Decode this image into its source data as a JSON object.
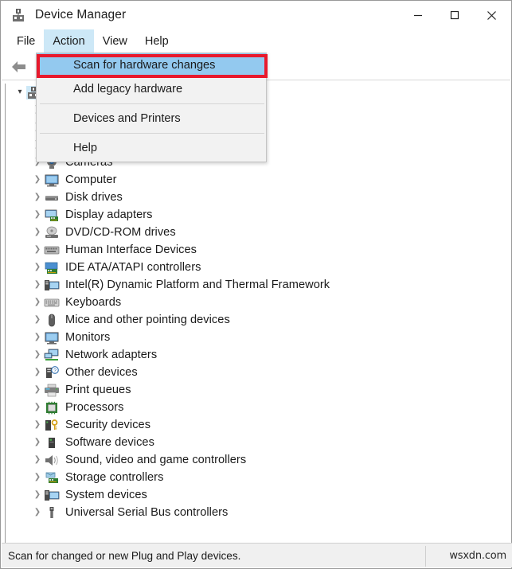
{
  "window": {
    "title": "Device Manager",
    "icon": "device-manager-icon",
    "controls": {
      "minimize": "—",
      "maximize": "□",
      "close": "✕"
    }
  },
  "menubar": {
    "items": [
      {
        "label": "File",
        "active": false
      },
      {
        "label": "Action",
        "active": true
      },
      {
        "label": "View",
        "active": false
      },
      {
        "label": "Help",
        "active": false
      }
    ]
  },
  "toolbar": {
    "buttons": [
      {
        "icon": "back-arrow-icon"
      },
      {
        "icon": "forward-arrow-icon"
      }
    ]
  },
  "dropdown": {
    "owner": "Action",
    "highlight_color": "#93c9ef",
    "annotation_color": "#e8192c",
    "items": [
      {
        "label": "Scan for hardware changes",
        "highlighted": true,
        "separator_after": false
      },
      {
        "label": "Add legacy hardware",
        "highlighted": false,
        "separator_after": true
      },
      {
        "label": "Devices and Printers",
        "highlighted": false,
        "separator_after": true
      },
      {
        "label": "Help",
        "highlighted": false,
        "separator_after": false
      }
    ]
  },
  "tree": {
    "root": {
      "label": "",
      "icon": "computer-root-icon",
      "expanded": true,
      "selected": true
    },
    "hidden_rows": 3,
    "items": [
      {
        "label": "Cameras",
        "icon": "camera-icon"
      },
      {
        "label": "Computer",
        "icon": "monitor-icon"
      },
      {
        "label": "Disk drives",
        "icon": "disk-drive-icon"
      },
      {
        "label": "Display adapters",
        "icon": "display-adapter-icon"
      },
      {
        "label": "DVD/CD-ROM drives",
        "icon": "optical-drive-icon"
      },
      {
        "label": "Human Interface Devices",
        "icon": "hid-icon"
      },
      {
        "label": "IDE ATA/ATAPI controllers",
        "icon": "ide-controller-icon"
      },
      {
        "label": "Intel(R) Dynamic Platform and Thermal Framework",
        "icon": "system-device-icon"
      },
      {
        "label": "Keyboards",
        "icon": "keyboard-icon"
      },
      {
        "label": "Mice and other pointing devices",
        "icon": "mouse-icon"
      },
      {
        "label": "Monitors",
        "icon": "monitor-icon"
      },
      {
        "label": "Network adapters",
        "icon": "network-adapter-icon"
      },
      {
        "label": "Other devices",
        "icon": "unknown-device-icon"
      },
      {
        "label": "Print queues",
        "icon": "printer-icon"
      },
      {
        "label": "Processors",
        "icon": "processor-icon"
      },
      {
        "label": "Security devices",
        "icon": "security-device-icon"
      },
      {
        "label": "Software devices",
        "icon": "software-device-icon"
      },
      {
        "label": "Sound, video and game controllers",
        "icon": "speaker-icon"
      },
      {
        "label": "Storage controllers",
        "icon": "storage-controller-icon"
      },
      {
        "label": "System devices",
        "icon": "system-device-icon"
      },
      {
        "label": "Universal Serial Bus controllers",
        "icon": "usb-icon"
      }
    ]
  },
  "statusbar": {
    "text": "Scan for changed or new Plug and Play devices.",
    "watermark": "wsxdn.com"
  }
}
